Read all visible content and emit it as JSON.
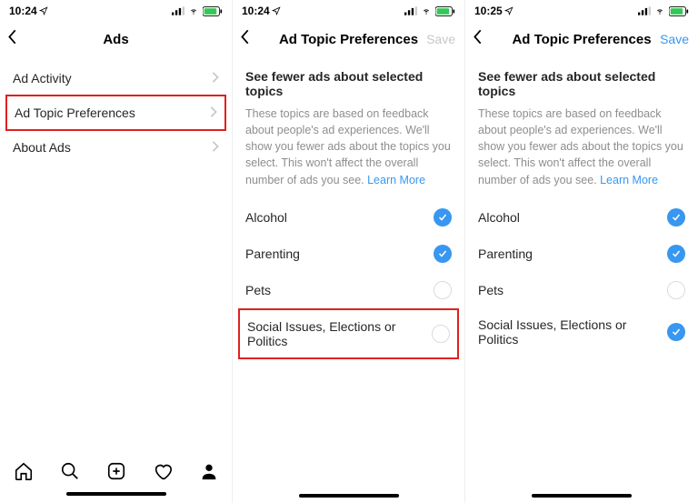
{
  "statusbar": {
    "time1": "10:24",
    "time2": "10:24",
    "time3": "10:25"
  },
  "screen1": {
    "title": "Ads",
    "items": {
      "activity": "Ad Activity",
      "topic_prefs": "Ad Topic Preferences",
      "about": "About Ads"
    }
  },
  "screen2": {
    "title": "Ad Topic Preferences",
    "save": "Save",
    "heading": "See fewer ads about selected topics",
    "desc": "These topics are based on feedback about people's ad experiences. We'll show you fewer ads about the topics you select. This won't affect the overall number of ads you see. ",
    "learn_more": "Learn More",
    "topics": {
      "alcohol": "Alcohol",
      "parenting": "Parenting",
      "pets": "Pets",
      "social": "Social Issues, Elections or Politics"
    }
  },
  "screen3": {
    "title": "Ad Topic Preferences",
    "save": "Save",
    "heading": "See fewer ads about selected topics",
    "desc": "These topics are based on feedback about people's ad experiences. We'll show you fewer ads about the topics you select. This won't affect the overall number of ads you see. ",
    "learn_more": "Learn More",
    "topics": {
      "alcohol": "Alcohol",
      "parenting": "Parenting",
      "pets": "Pets",
      "social": "Social Issues, Elections or Politics"
    }
  }
}
